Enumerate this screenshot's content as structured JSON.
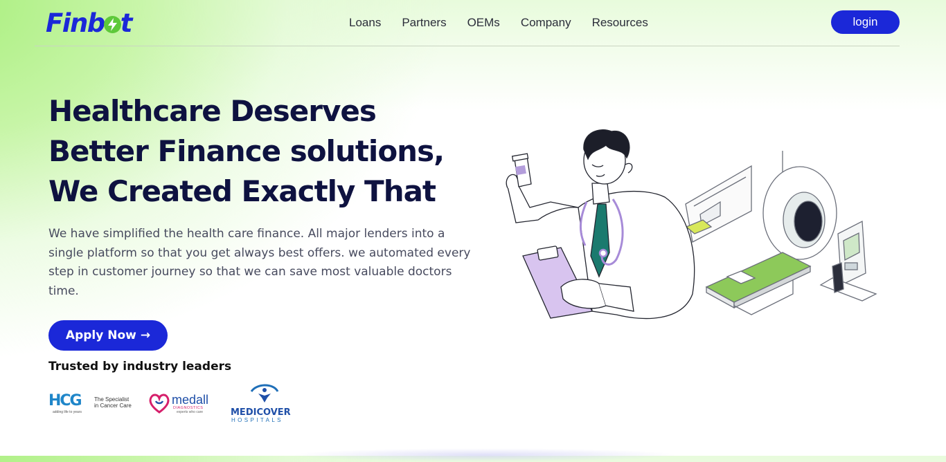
{
  "brand": {
    "name_part1": "Finb",
    "name_part2": "t"
  },
  "nav": {
    "items": [
      "Loans",
      "Partners",
      "OEMs",
      "Company",
      "Resources"
    ]
  },
  "header": {
    "login_label": "login"
  },
  "hero": {
    "headline_lines": [
      "Healthcare Deserves",
      "Better Finance solutions,",
      "We Created Exactly That"
    ],
    "description": "We have simplified the health care finance. All major lenders into a single platform so that you get always best offers. we automated every step in customer journey so that we can save most valuable doctors time.",
    "cta_label": "Apply Now",
    "cta_arrow": "→",
    "trusted_label": "Trusted by industry leaders"
  },
  "partners": {
    "hcg": {
      "mark": "HCG",
      "tagline_1": "The Specialist",
      "tagline_2": "in Cancer Care",
      "sub": "adding life to years"
    },
    "medall": {
      "name": "medall",
      "sub_1": "DIAGNOSTICS",
      "sub_2": "experts who care"
    },
    "medicover": {
      "name_1": "MEDICOVER",
      "name_2": "HOSPITALS"
    }
  },
  "colors": {
    "primary": "#1b28d8",
    "accent_green": "#5ec93a",
    "heading": "#0e1240",
    "body": "#474a5e"
  },
  "icons": [
    "bolt-icon",
    "arrow-right-icon",
    "doctor-illustration",
    "mri-scanner-illustration"
  ]
}
